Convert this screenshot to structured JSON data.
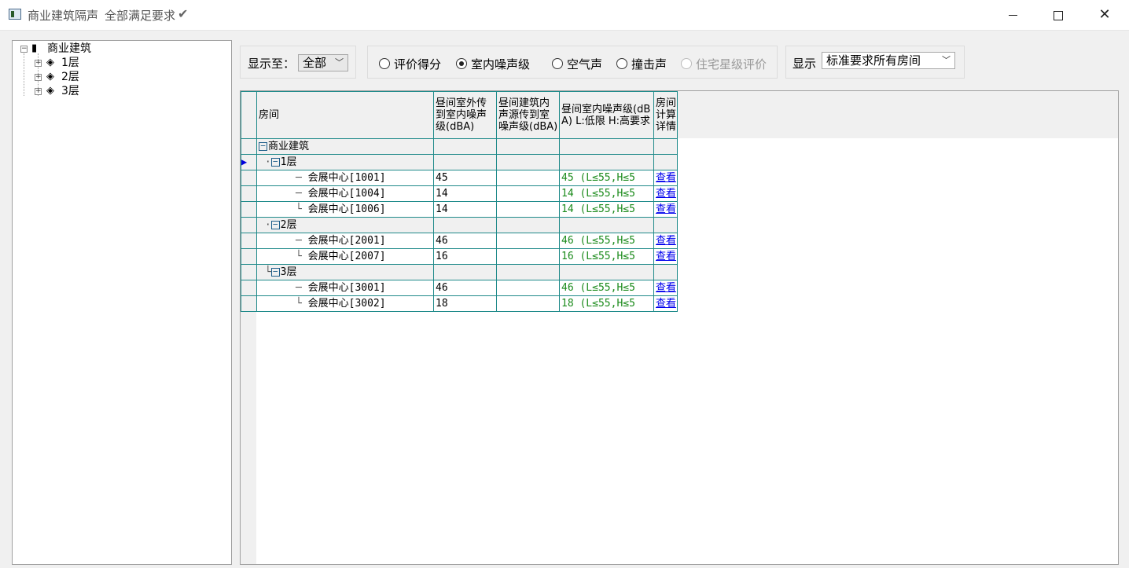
{
  "window": {
    "title": "商业建筑隔声",
    "status": "全部满足要求",
    "check_glyph": "✔",
    "close_glyph": "✕"
  },
  "tree": {
    "root": "商业建筑",
    "floors": [
      "1层",
      "2层",
      "3层"
    ]
  },
  "toolbar": {
    "show_to_label": "显示至：",
    "show_to_value": "全部",
    "radios": [
      {
        "label": "评价得分",
        "checked": false,
        "disabled": false
      },
      {
        "label": "室内噪声级",
        "checked": true,
        "disabled": false
      },
      {
        "label": "空气声",
        "checked": false,
        "disabled": false
      },
      {
        "label": "撞击声",
        "checked": false,
        "disabled": false
      },
      {
        "label": "住宅星级评价",
        "checked": false,
        "disabled": true
      }
    ],
    "display_label": "显示",
    "display_value": "标准要求所有房间"
  },
  "grid": {
    "columns": [
      "房间",
      "昼间室外传到室内噪声级(dBA)",
      "昼间建筑内声源传到室噪声级(dBA)",
      "昼间室内噪声级(dBA) L:低限 H:高要求",
      "房间计算详情"
    ],
    "root_label": "商业建筑",
    "groups": [
      {
        "label": "1层",
        "rows": [
          {
            "room": "会展中心[1001]",
            "outdoor": "45",
            "indoor": "",
            "level": "45 (L≤55,H≤5",
            "link": "查看"
          },
          {
            "room": "会展中心[1004]",
            "outdoor": "14",
            "indoor": "",
            "level": "14 (L≤55,H≤5",
            "link": "查看"
          },
          {
            "room": "会展中心[1006]",
            "outdoor": "14",
            "indoor": "",
            "level": "14 (L≤55,H≤5",
            "link": "查看"
          }
        ]
      },
      {
        "label": "2层",
        "rows": [
          {
            "room": "会展中心[2001]",
            "outdoor": "46",
            "indoor": "",
            "level": "46 (L≤55,H≤5",
            "link": "查看"
          },
          {
            "room": "会展中心[2007]",
            "outdoor": "16",
            "indoor": "",
            "level": "16 (L≤55,H≤5",
            "link": "查看"
          }
        ]
      },
      {
        "label": "3层",
        "rows": [
          {
            "room": "会展中心[3001]",
            "outdoor": "46",
            "indoor": "",
            "level": "46 (L≤55,H≤5",
            "link": "查看"
          },
          {
            "room": "会展中心[3002]",
            "outdoor": "18",
            "indoor": "",
            "level": "18 (L≤55,H≤5",
            "link": "查看"
          }
        ]
      }
    ]
  }
}
